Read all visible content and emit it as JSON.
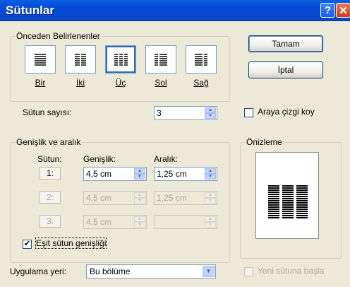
{
  "title": "Sütunlar",
  "presets": {
    "legend": "Önceden Belirlenenler",
    "items": [
      {
        "label": "Bir"
      },
      {
        "label": "İki"
      },
      {
        "label": "Üç"
      },
      {
        "label": "Sol"
      },
      {
        "label": "Sağ"
      }
    ],
    "selected": "Üç"
  },
  "buttons": {
    "ok": "Tamam",
    "cancel": "İptal"
  },
  "column_count": {
    "label": "Sütun sayısı:",
    "value": "3"
  },
  "line_between": {
    "label": "Araya çizgi koy",
    "checked": false
  },
  "width_spacing": {
    "legend": "Genişlik ve aralık",
    "headers": {
      "col": "Sütun:",
      "width": "Genişlik:",
      "spacing": "Aralık:"
    },
    "rows": [
      {
        "col": "1:",
        "width": "4,5 cm",
        "spacing": "1,25 cm"
      },
      {
        "col": "2:",
        "width": "4,5 cm",
        "spacing": "1,25 cm"
      },
      {
        "col": "3:",
        "width": "4,5 cm",
        "spacing": ""
      }
    ]
  },
  "equal_width": {
    "label": "Eşit sütun genişliği",
    "checked": true
  },
  "preview": {
    "legend": "Önizleme"
  },
  "apply_to": {
    "label": "Uygulama yeri:",
    "value": "Bu bölüme"
  },
  "new_column": {
    "label": "Yeni sütuna başla",
    "checked": false
  },
  "colors": {
    "title_bar": "#0a5fe0",
    "dialog_bg": "#ece9d8",
    "selected_outline": "#316ac5"
  }
}
